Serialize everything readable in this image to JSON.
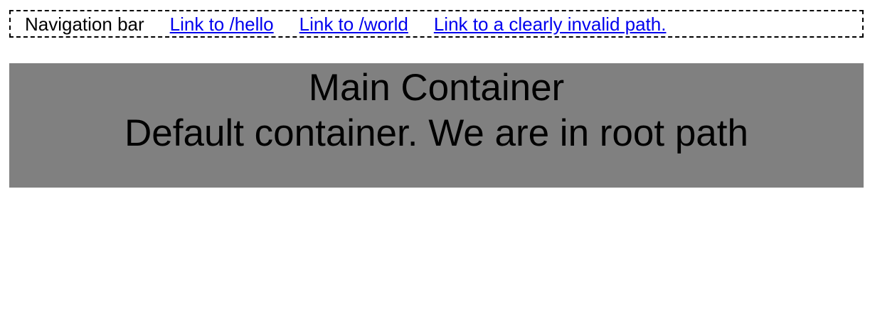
{
  "nav": {
    "label": "Navigation bar",
    "links": [
      {
        "text": "Link to /hello"
      },
      {
        "text": "Link to /world"
      },
      {
        "text": "Link to a clearly invalid path."
      }
    ],
    "link_color": "#0000ee"
  },
  "main": {
    "title": "Main Container",
    "message": "Default container. We are in root path",
    "background": "#808080"
  }
}
